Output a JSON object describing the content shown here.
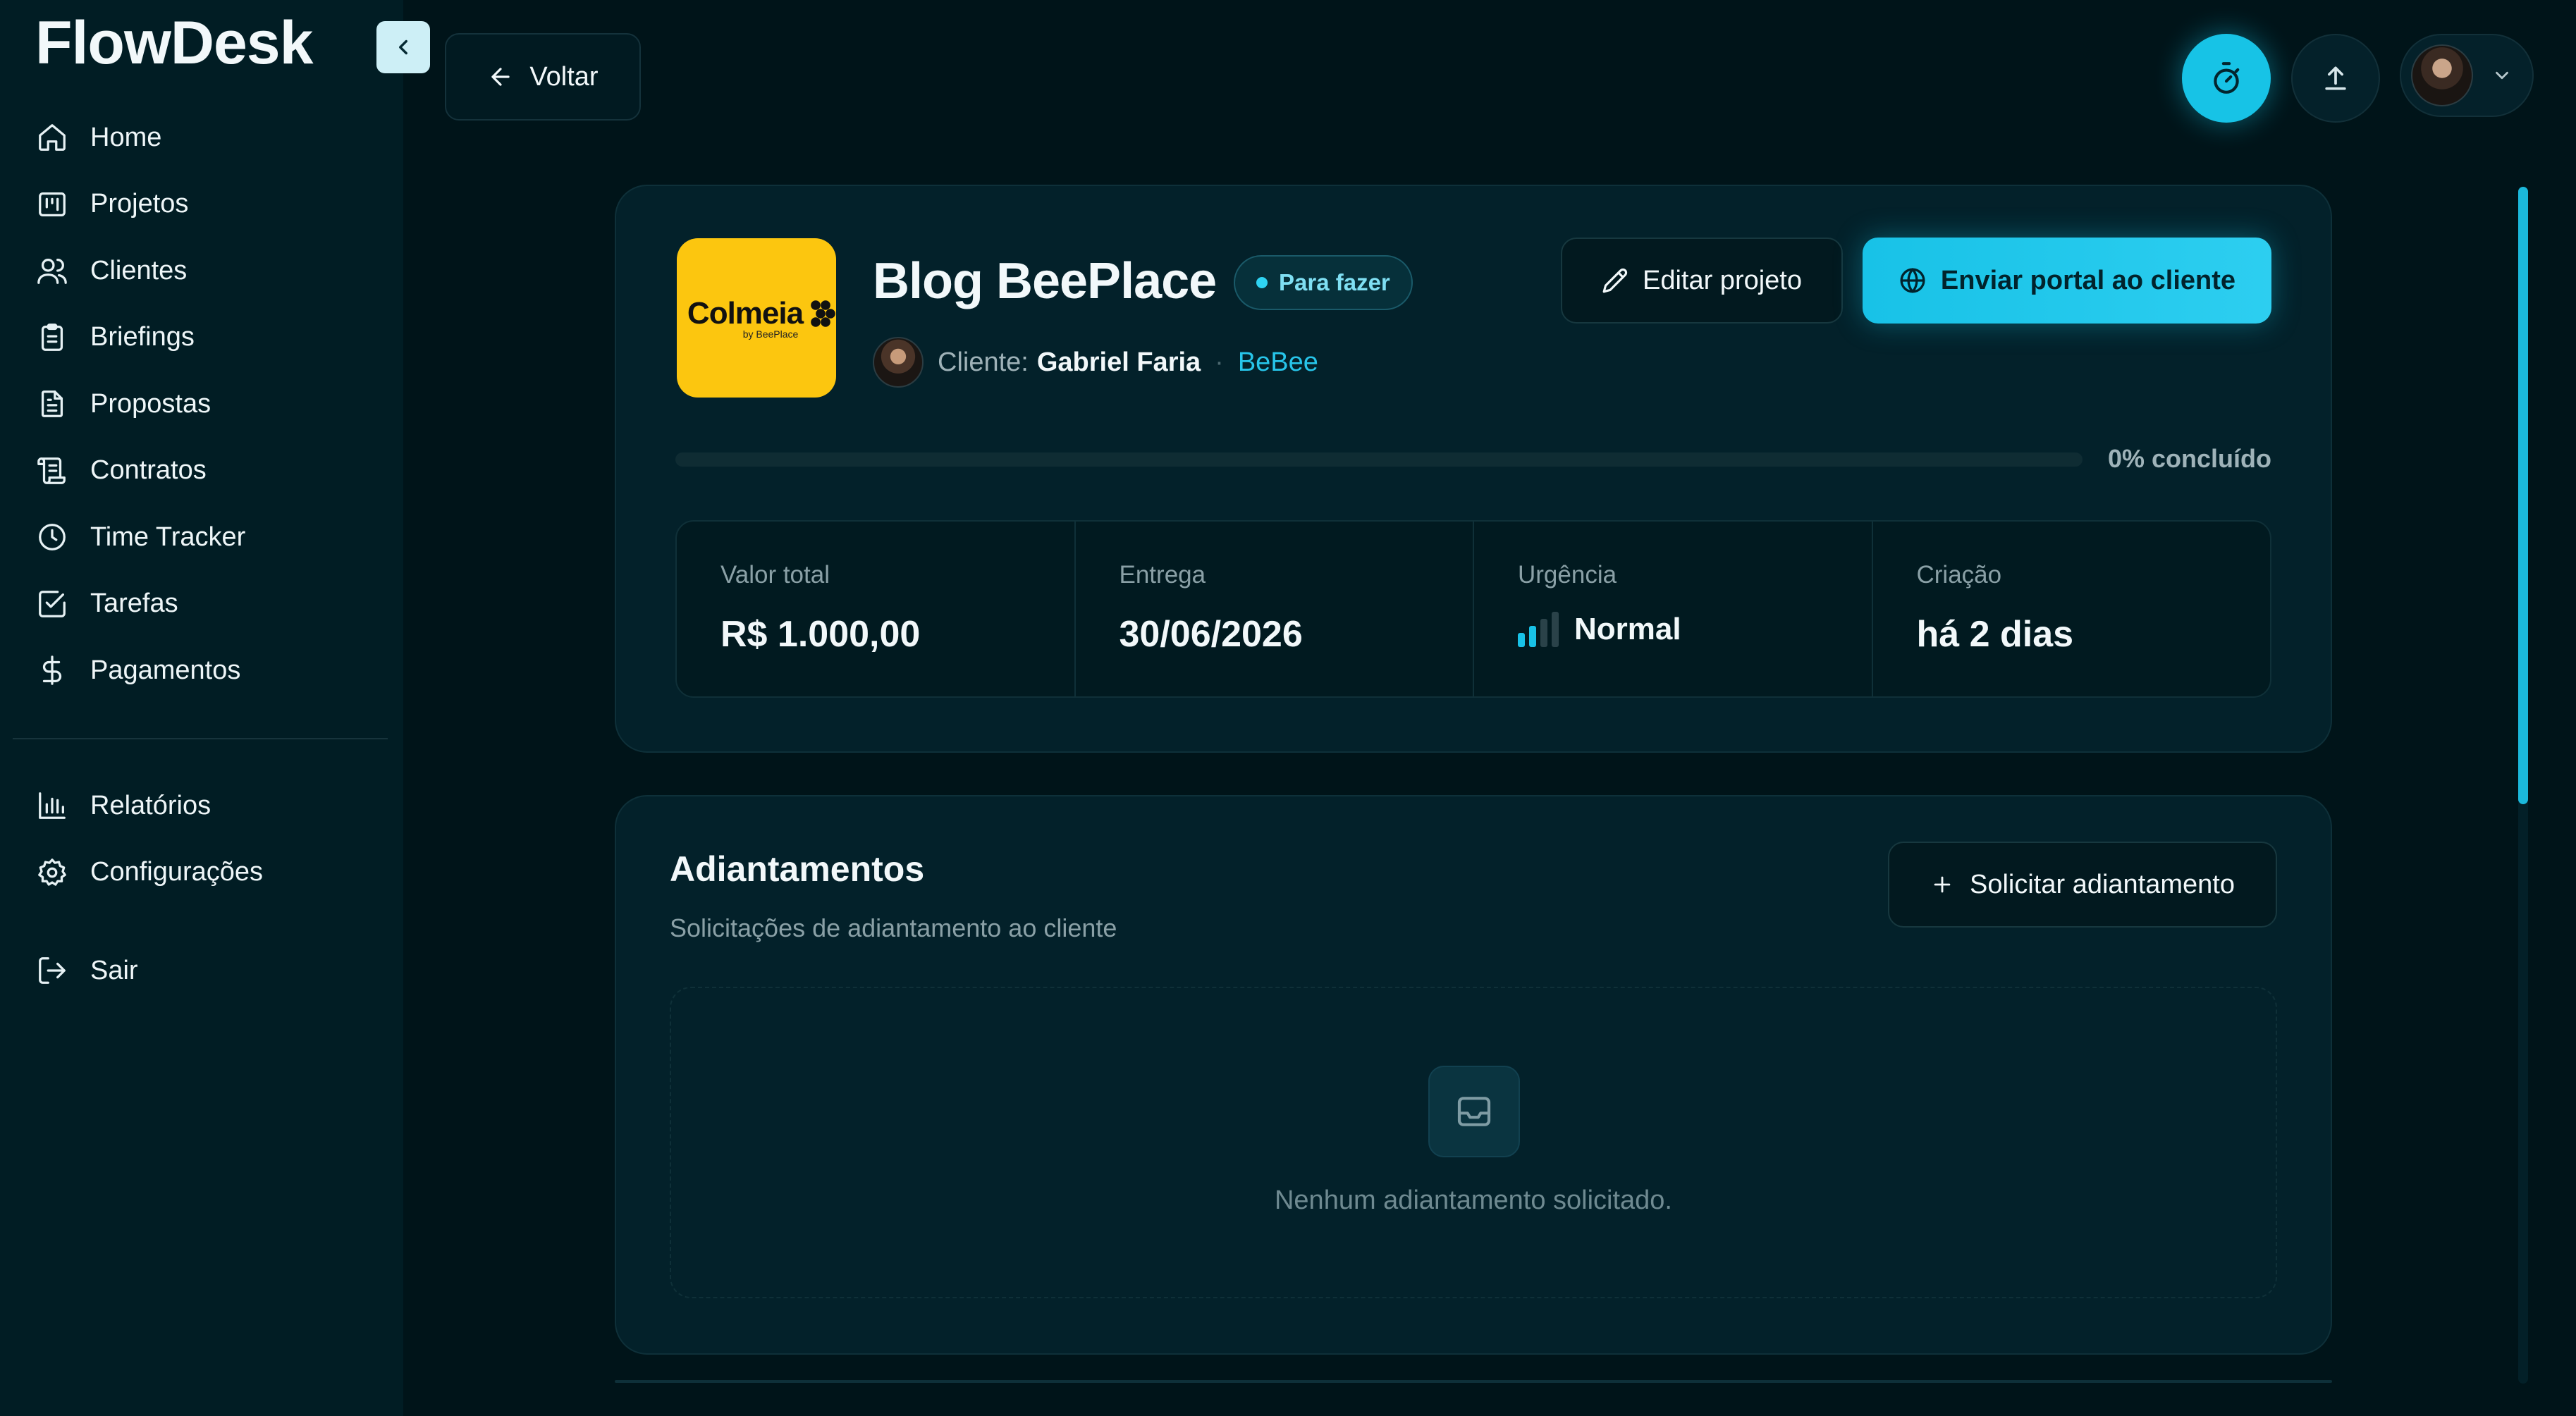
{
  "app": {
    "brand": "FlowDesk"
  },
  "sidebar": {
    "items": [
      {
        "label": "Home",
        "icon": "home-icon"
      },
      {
        "label": "Projetos",
        "icon": "kanban-icon"
      },
      {
        "label": "Clientes",
        "icon": "users-icon"
      },
      {
        "label": "Briefings",
        "icon": "clipboard-icon"
      },
      {
        "label": "Propostas",
        "icon": "file-text-icon"
      },
      {
        "label": "Contratos",
        "icon": "scroll-icon"
      },
      {
        "label": "Time Tracker",
        "icon": "clock-icon"
      },
      {
        "label": "Tarefas",
        "icon": "check-square-icon"
      },
      {
        "label": "Pagamentos",
        "icon": "dollar-icon"
      }
    ],
    "secondary": [
      {
        "label": "Relatórios",
        "icon": "bar-chart-icon"
      },
      {
        "label": "Configurações",
        "icon": "gear-icon"
      }
    ],
    "logout": {
      "label": "Sair",
      "icon": "logout-icon"
    }
  },
  "topbar": {
    "back_label": "Voltar"
  },
  "project": {
    "title": "Blog BeePlace",
    "status": "Para fazer",
    "client_prefix": "Cliente:",
    "client_name": "Gabriel Faria",
    "separator": "·",
    "company": "BeBee",
    "logo_word": "Colmeia",
    "logo_sub": "by BeePlace",
    "edit_label": "Editar projeto",
    "portal_label": "Enviar portal ao cliente",
    "progress_percent": 0,
    "progress_label": "0% concluído",
    "stats": {
      "total": {
        "label": "Valor total",
        "value": "R$ 1.000,00"
      },
      "delivery": {
        "label": "Entrega",
        "value": "30/06/2026"
      },
      "urgency": {
        "label": "Urgência",
        "value": "Normal",
        "level": 2,
        "max_level": 4
      },
      "created": {
        "label": "Criação",
        "value": "há 2 dias"
      }
    }
  },
  "advances": {
    "title": "Adiantamentos",
    "subtitle": "Solicitações de adiantamento ao cliente",
    "request_label": "Solicitar adiantamento",
    "empty_text": "Nenhum adiantamento solicitado."
  },
  "colors": {
    "accent": "#18c2e7",
    "background": "#001419",
    "sidebar": "#011d24",
    "card": "#03212a",
    "logo_bg": "#fcc60f"
  }
}
